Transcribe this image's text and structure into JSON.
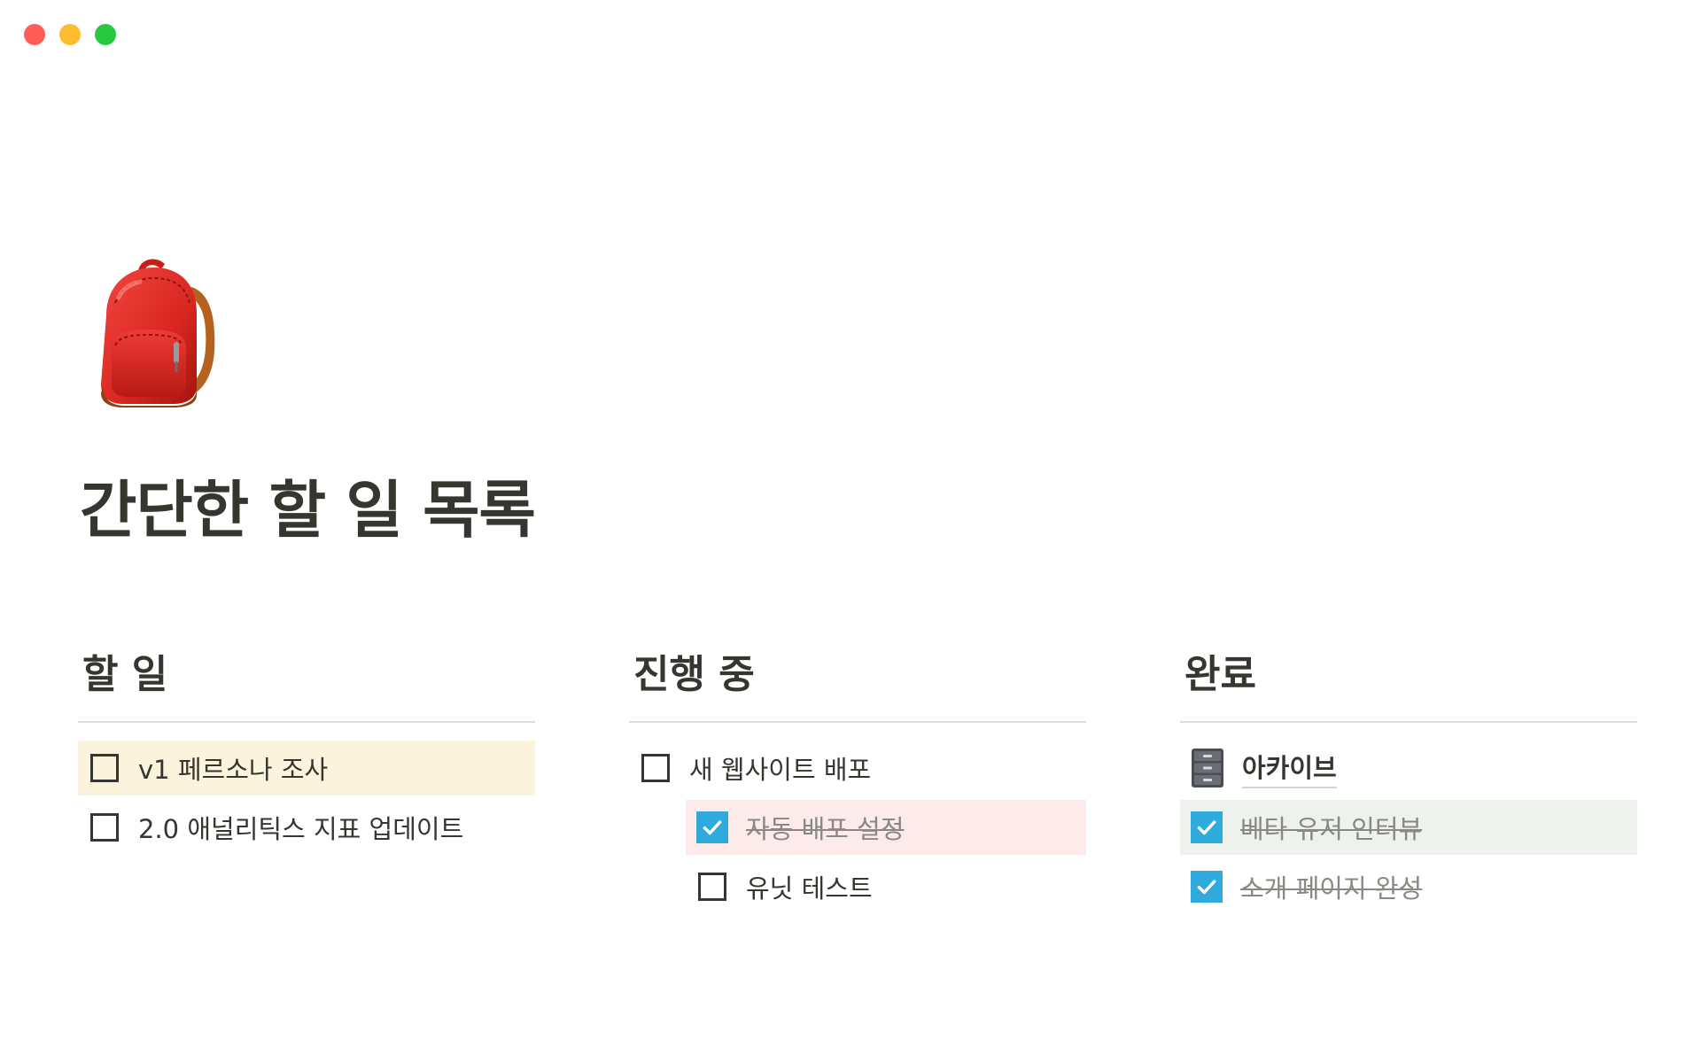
{
  "colors": {
    "close": "#ff5f57",
    "minimize": "#febc2e",
    "maximize": "#28c840",
    "text": "#37352f",
    "checkbox_checked": "#2eaadc",
    "highlight_yellow": "#fbf3db",
    "highlight_red": "#fdebec",
    "highlight_green": "#edf3ec"
  },
  "page": {
    "icon": "backpack-icon",
    "title": "간단한 할 일 목록"
  },
  "columns": {
    "todo": {
      "heading": "할 일",
      "items": [
        {
          "label": "v1 페르소나 조사",
          "checked": false,
          "highlight": "yellow"
        },
        {
          "label": "2.0 애널리틱스 지표 업데이트",
          "checked": false
        }
      ]
    },
    "in_progress": {
      "heading": "진행 중",
      "items": [
        {
          "label": "새 웹사이트 배포",
          "checked": false
        },
        {
          "label": "자동 배포 설정",
          "checked": true,
          "highlight": "red"
        },
        {
          "label": "유닛 테스트",
          "checked": false
        }
      ]
    },
    "done": {
      "heading": "완료",
      "archive": {
        "icon": "file-cabinet-icon",
        "label": "아카이브"
      },
      "items": [
        {
          "label": "베타 유저 인터뷰",
          "checked": true,
          "highlight": "green"
        },
        {
          "label": "소개 페이지 완성",
          "checked": true
        }
      ]
    }
  }
}
